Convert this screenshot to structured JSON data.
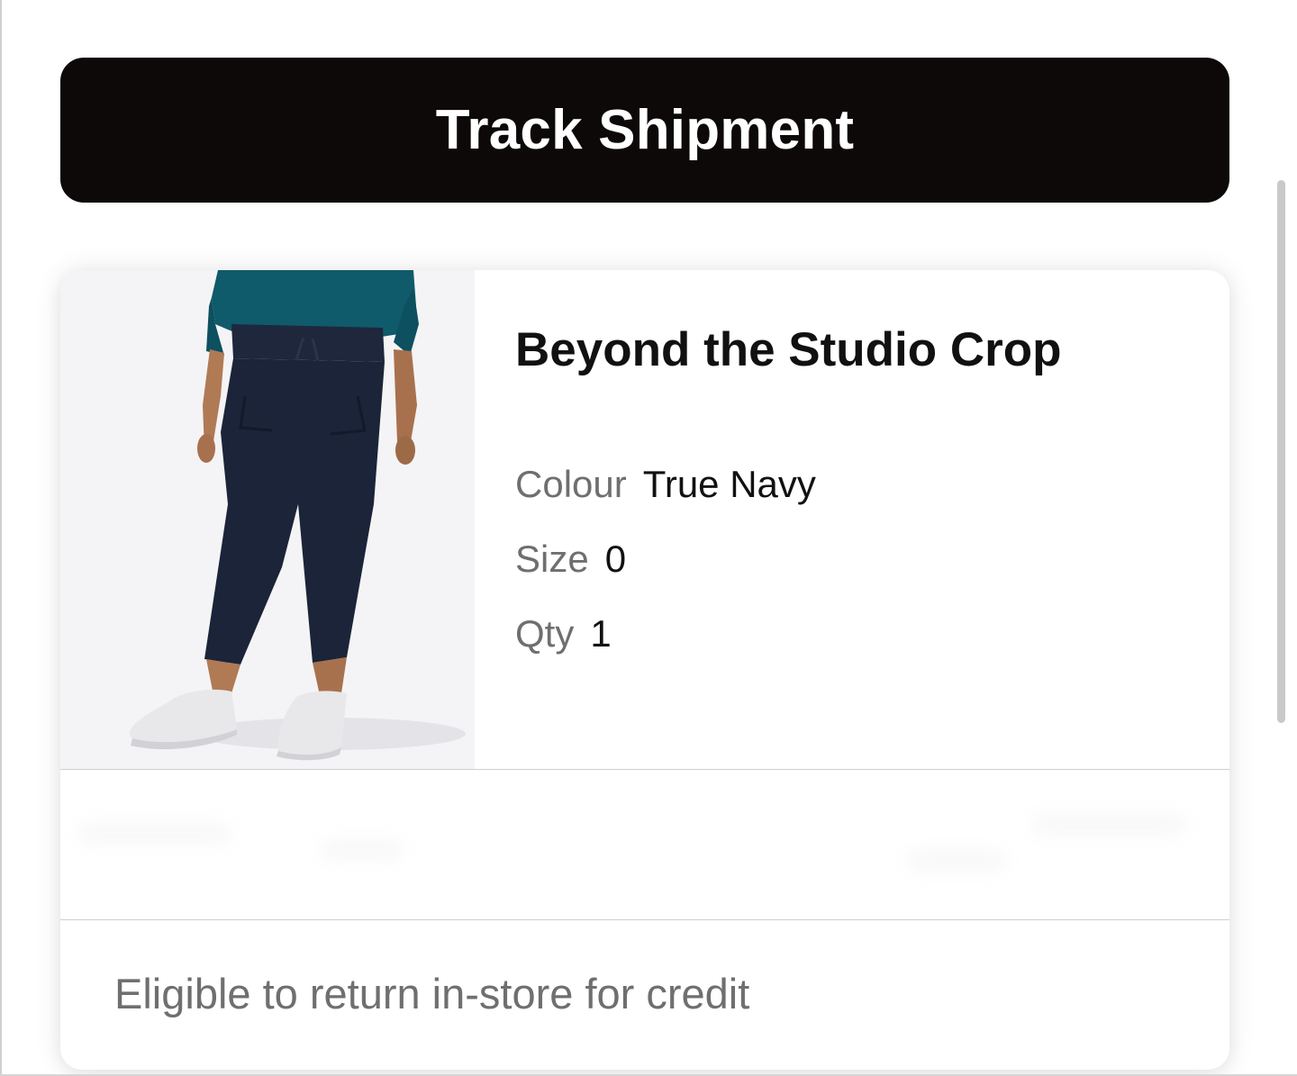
{
  "actions": {
    "track_shipment_label": "Track Shipment"
  },
  "item": {
    "title": "Beyond the Studio Crop",
    "colour_label": "Colour",
    "colour_value": "True Navy",
    "size_label": "Size",
    "size_value": "0",
    "qty_label": "Qty",
    "qty_value": "1",
    "image_alt": "Model wearing navy cropped pants with white sneakers"
  },
  "return_info": {
    "text": "Eligible to return in-store for credit"
  },
  "colors": {
    "button_bg": "#0d0909",
    "muted_text": "#6f6f6f",
    "pants": "#1b2438",
    "top": "#0f5a6b"
  }
}
